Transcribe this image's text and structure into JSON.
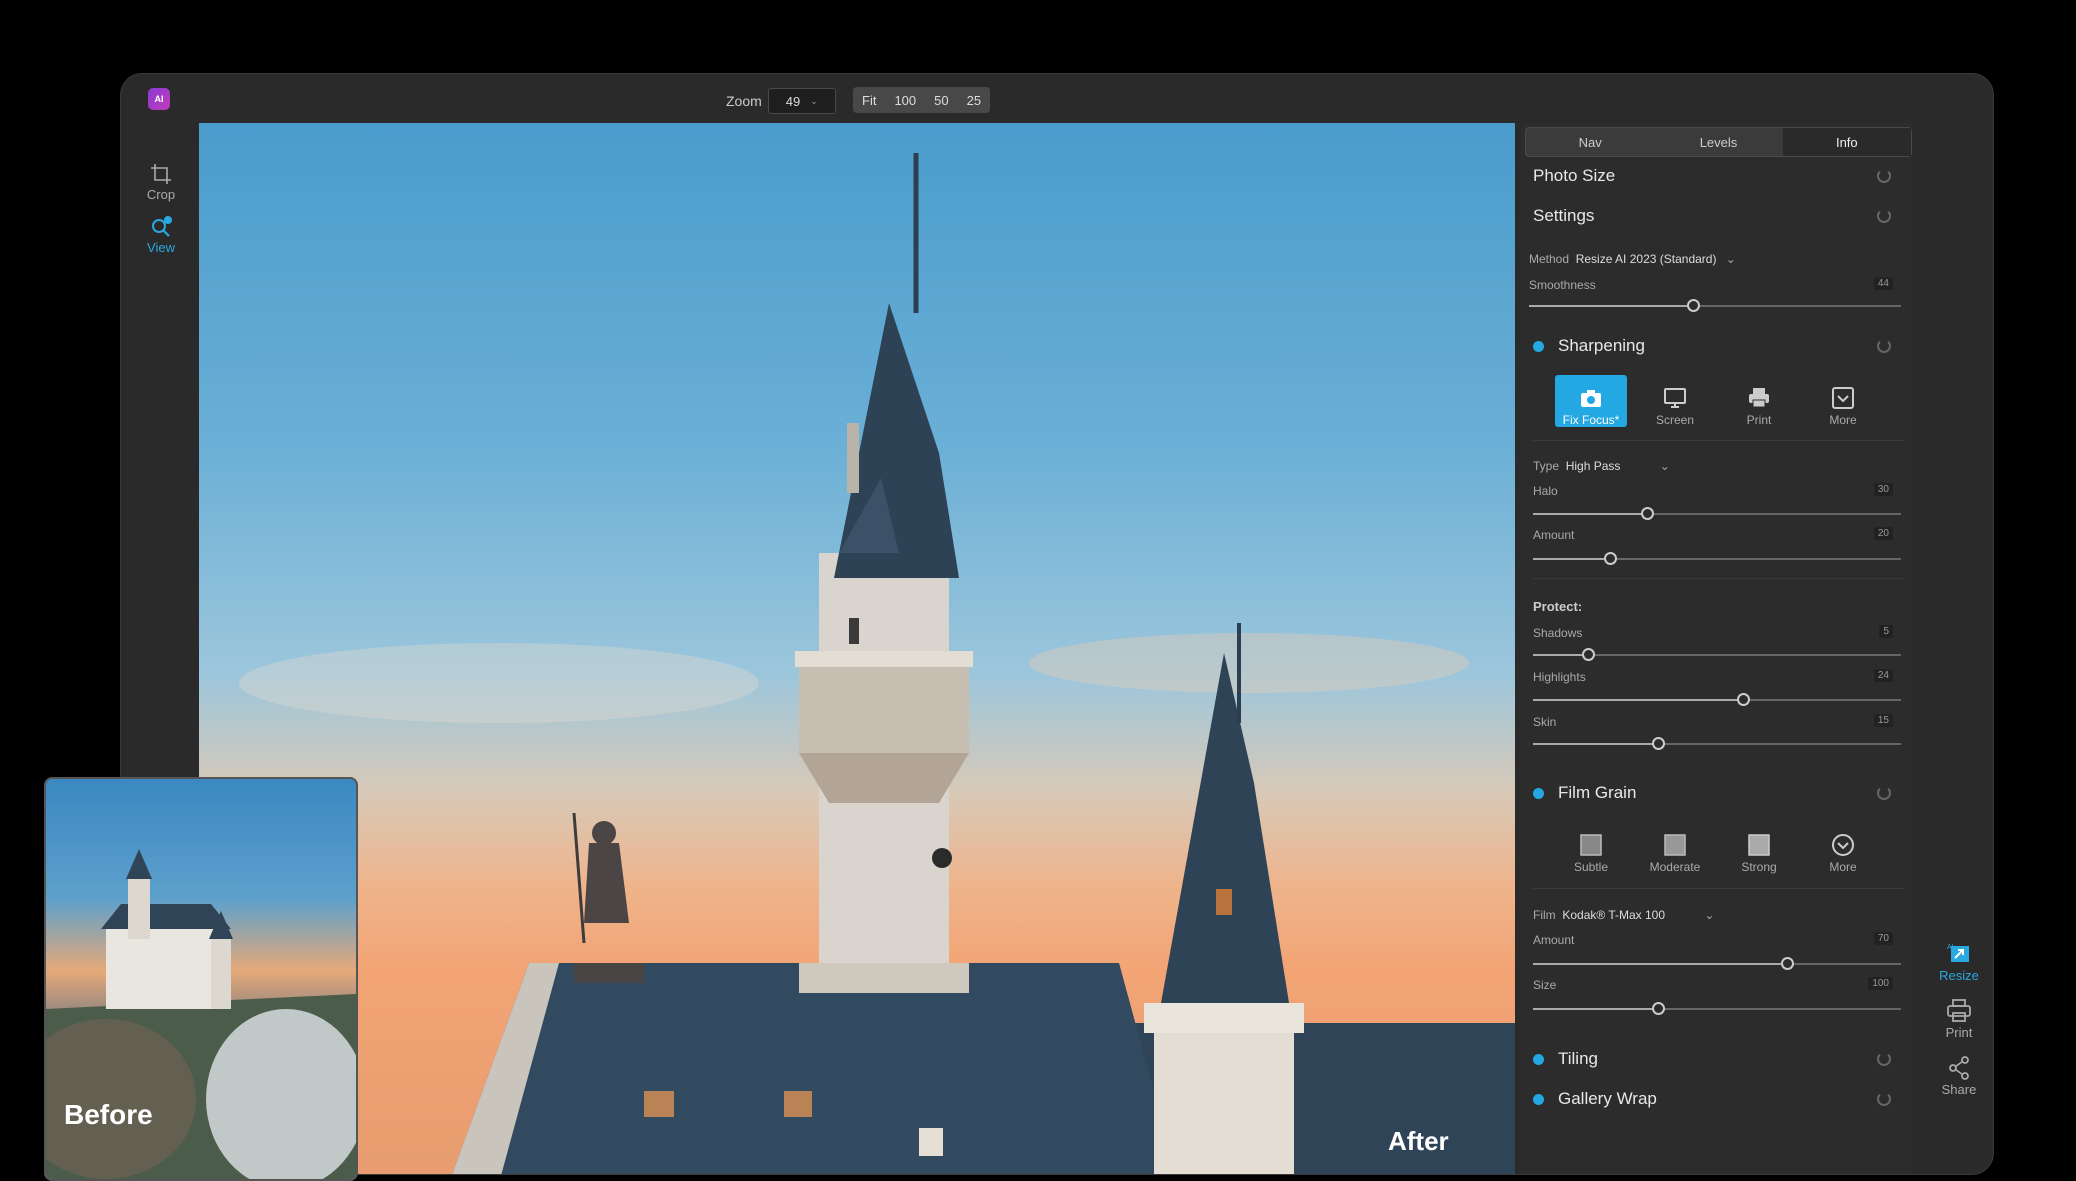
{
  "app": {
    "logo_text": "AI"
  },
  "zoom": {
    "label": "Zoom",
    "value": "49",
    "buttons": [
      "Fit",
      "100",
      "50",
      "25"
    ]
  },
  "left_tools": [
    {
      "label": "Crop",
      "icon": "crop-icon",
      "active": false
    },
    {
      "label": "View",
      "icon": "magnifier-icon",
      "active": true
    }
  ],
  "panel": {
    "tabs": [
      "Nav",
      "Levels",
      "Info"
    ],
    "active_tab": "Info",
    "photo_size": "Photo Size",
    "settings": {
      "title": "Settings",
      "method_label": "Method",
      "method_value": "Resize AI 2023 (Standard)",
      "smoothness_label": "Smoothness",
      "smoothness_value": "44",
      "smoothness_fraction": 0.44
    },
    "sharpening": {
      "title": "Sharpening",
      "presets": [
        "Fix Focus*",
        "Screen",
        "Print",
        "More"
      ],
      "type_label": "Type",
      "type_value": "High Pass",
      "halo_label": "Halo",
      "halo_value": "30",
      "halo_fraction": 0.31,
      "amount_label": "Amount",
      "amount_value": "20",
      "amount_fraction": 0.21,
      "protect_label": "Protect:",
      "shadows_label": "Shadows",
      "shadows_value": "5",
      "shadows_fraction": 0.15,
      "highlights_label": "Highlights",
      "highlights_value": "24",
      "highlights_fraction": 0.57,
      "skin_label": "Skin",
      "skin_value": "15",
      "skin_fraction": 0.34
    },
    "film_grain": {
      "title": "Film Grain",
      "presets": [
        "Subtle",
        "Moderate",
        "Strong",
        "More"
      ],
      "film_label": "Film",
      "film_value": "Kodak® T-Max 100",
      "amount_label": "Amount",
      "amount_value": "70",
      "amount_fraction": 0.69,
      "size_label": "Size",
      "size_value": "100",
      "size_fraction": 0.34
    },
    "tiling": "Tiling",
    "gallery_wrap": "Gallery Wrap"
  },
  "right_tools": [
    {
      "label": "Resize",
      "icon": "resize-ai-icon",
      "active": true
    },
    {
      "label": "Print",
      "icon": "printer-icon",
      "active": false
    },
    {
      "label": "Share",
      "icon": "share-icon",
      "active": false
    }
  ],
  "before_label": "Before",
  "after_label": "After",
  "colors": {
    "accent": "#23a8e4",
    "panel": "#2c2c2d",
    "window": "#2a2a2b"
  }
}
